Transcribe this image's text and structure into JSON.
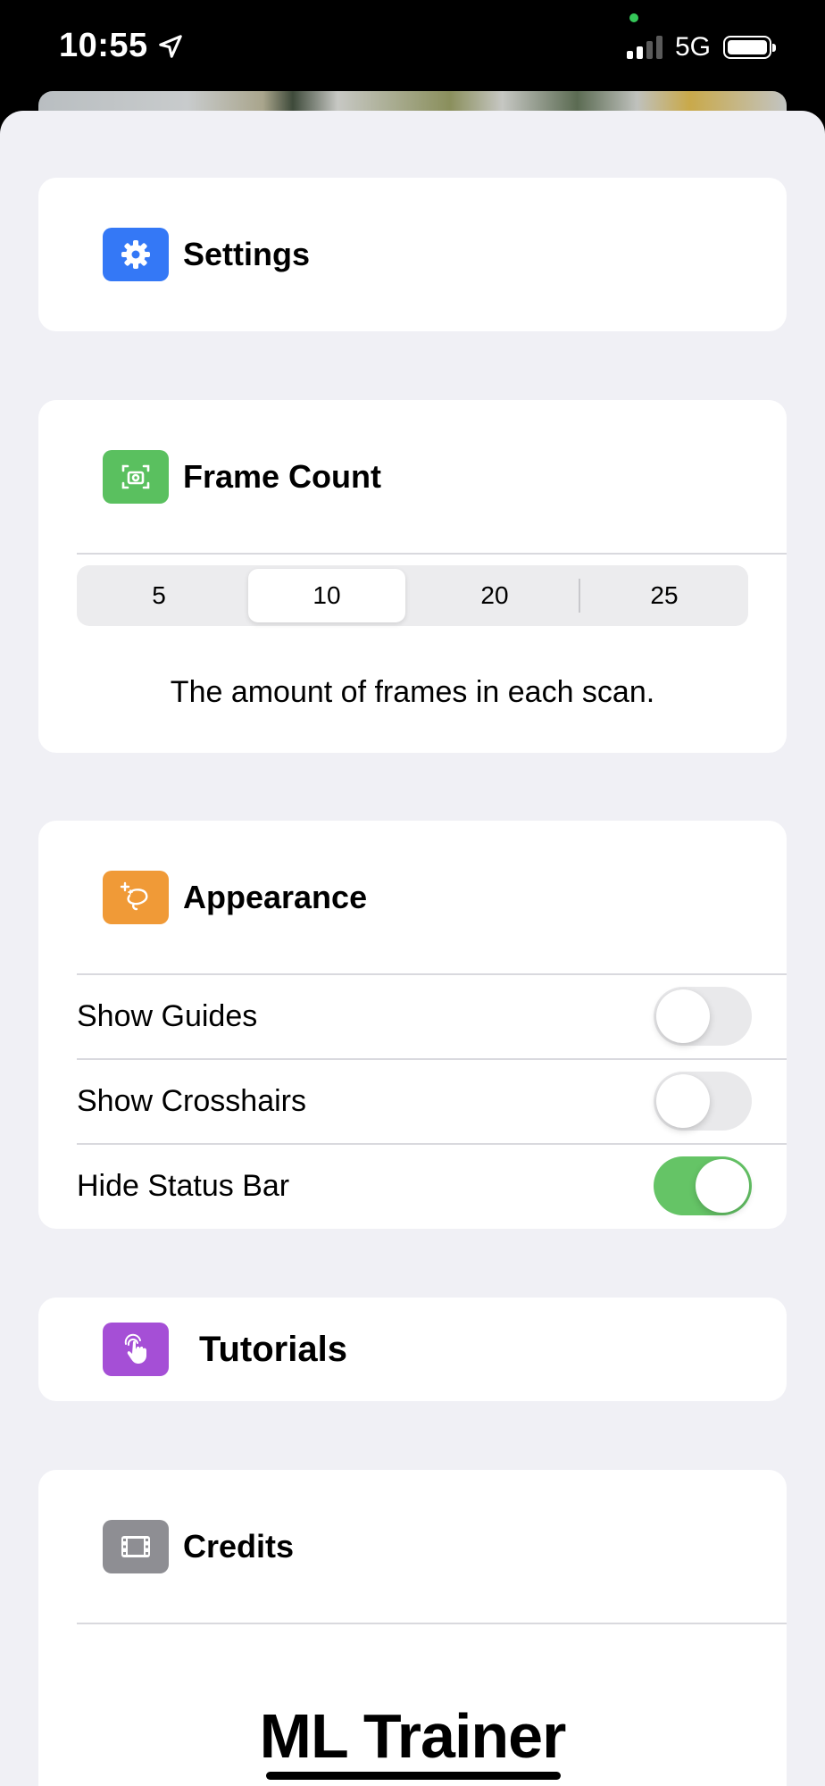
{
  "status_bar": {
    "time": "10:55",
    "network": "5G"
  },
  "settings": {
    "title": "Settings",
    "icon": "gear-icon",
    "icon_color": "#3478f6"
  },
  "frame_count": {
    "title": "Frame Count",
    "icon": "camera-viewfinder-icon",
    "icon_color": "#5ac05f",
    "options": [
      "5",
      "10",
      "20",
      "25"
    ],
    "selected": "10",
    "caption": "The amount of frames in each scan."
  },
  "appearance": {
    "title": "Appearance",
    "icon": "sparkles-lasso-icon",
    "icon_color": "#f09a37",
    "toggles": [
      {
        "label": "Show Guides",
        "on": false
      },
      {
        "label": "Show Crosshairs",
        "on": false
      },
      {
        "label": "Hide Status Bar",
        "on": true
      }
    ],
    "toggle_on_color": "#65c466"
  },
  "tutorials": {
    "title": "Tutorials",
    "icon": "hand-tap-icon",
    "icon_color": "#a54fd6"
  },
  "credits": {
    "title": "Credits",
    "icon": "film-icon",
    "icon_color": "#8e8e93",
    "brand": "ML Trainer"
  }
}
